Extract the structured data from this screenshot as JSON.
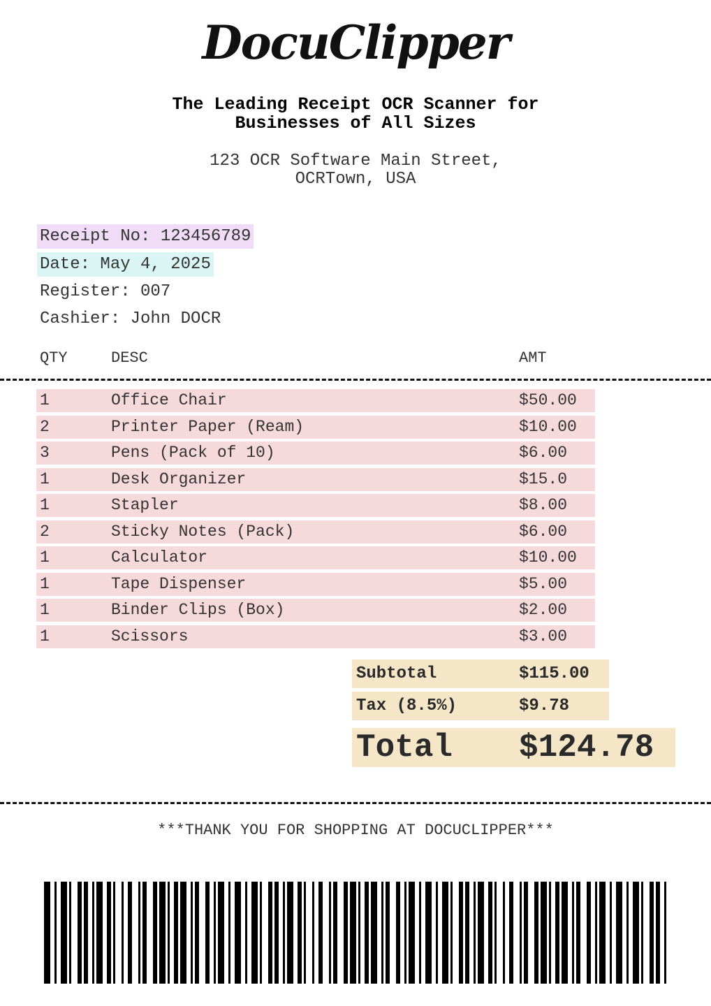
{
  "header": {
    "logo_text": "DocuClipper",
    "tagline_line1": "The Leading Receipt OCR Scanner for",
    "tagline_line2": "Businesses of All Sizes",
    "address_line1": "123 OCR Software Main Street,",
    "address_line2": "OCRTown, USA"
  },
  "receipt": {
    "receipt_no": "Receipt No: 123456789",
    "date": "Date: May 4, 2025",
    "register": "Register: 007",
    "cashier": "Cashier: John DOCR"
  },
  "columns": {
    "qty": "QTY",
    "desc": "DESC",
    "amt": "AMT"
  },
  "items": [
    {
      "qty": "1",
      "desc": "Office Chair",
      "amt": "$50.00"
    },
    {
      "qty": "2",
      "desc": "Printer Paper (Ream)",
      "amt": "$10.00"
    },
    {
      "qty": "3",
      "desc": "Pens (Pack of 10)",
      "amt": "$6.00"
    },
    {
      "qty": "1",
      "desc": "Desk Organizer",
      "amt": "$15.0"
    },
    {
      "qty": "1",
      "desc": "Stapler",
      "amt": "$8.00"
    },
    {
      "qty": "2",
      "desc": "Sticky Notes (Pack)",
      "amt": "$6.00"
    },
    {
      "qty": "1",
      "desc": "Calculator",
      "amt": "$10.00"
    },
    {
      "qty": "1",
      "desc": "Tape Dispenser",
      "amt": "$5.00"
    },
    {
      "qty": "1",
      "desc": "Binder Clips (Box)",
      "amt": "$2.00"
    },
    {
      "qty": "1",
      "desc": "Scissors",
      "amt": "$3.00"
    }
  ],
  "summary": {
    "subtotal_label": "Subtotal",
    "subtotal_value": "$115.00",
    "tax_label": "Tax (8.5%)",
    "tax_value": "$9.78",
    "total_label": "Total",
    "total_value": "$124.78"
  },
  "footer": {
    "thanks": "***THANK YOU FOR SHOPPING AT DOCUCLIPPER***"
  },
  "colors": {
    "receipt_no_highlight": "#f0dcf6",
    "date_highlight": "#d9f6f4",
    "item_highlight": "#f6d9db",
    "summary_highlight": "#f4e6c7"
  }
}
